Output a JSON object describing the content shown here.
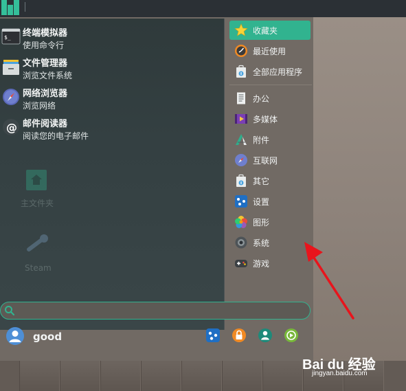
{
  "favorites": [
    {
      "name": "终端模拟器",
      "desc": "使用命令行",
      "icon": "terminal-icon"
    },
    {
      "name": "文件管理器",
      "desc": "浏览文件系统",
      "icon": "file-manager-icon"
    },
    {
      "name": "网络浏览器",
      "desc": "浏览网络",
      "icon": "web-browser-icon"
    },
    {
      "name": "邮件阅读器",
      "desc": "阅读您的电子邮件",
      "icon": "mail-icon"
    }
  ],
  "desktop_ghosts": {
    "home": "主文件夹",
    "steam": "Steam"
  },
  "categories": [
    {
      "label": "收藏夹",
      "icon": "star-icon",
      "active": true
    },
    {
      "label": "最近使用",
      "icon": "recent-icon"
    },
    {
      "label": "全部应用程序",
      "icon": "all-apps-icon"
    },
    {
      "label": "办公",
      "icon": "office-icon"
    },
    {
      "label": "多媒体",
      "icon": "multimedia-icon"
    },
    {
      "label": "附件",
      "icon": "accessories-icon"
    },
    {
      "label": "互联网",
      "icon": "internet-icon"
    },
    {
      "label": "其它",
      "icon": "other-icon"
    },
    {
      "label": "设置",
      "icon": "settings-icon"
    },
    {
      "label": "图形",
      "icon": "graphics-icon"
    },
    {
      "label": "系统",
      "icon": "system-icon"
    },
    {
      "label": "游戏",
      "icon": "games-icon"
    }
  ],
  "search": {
    "placeholder": "",
    "value": ""
  },
  "user": {
    "name": "good"
  },
  "system_buttons": [
    "settings-manager-icon",
    "lock-screen-icon",
    "switch-user-icon",
    "logout-icon"
  ],
  "watermark": {
    "logo": "Bai du 经验",
    "sub": "jingyan.baidu.com"
  },
  "colors": {
    "accent": "#31b38f",
    "taskbar": "#2b3035",
    "arrow": "#e8141c"
  }
}
